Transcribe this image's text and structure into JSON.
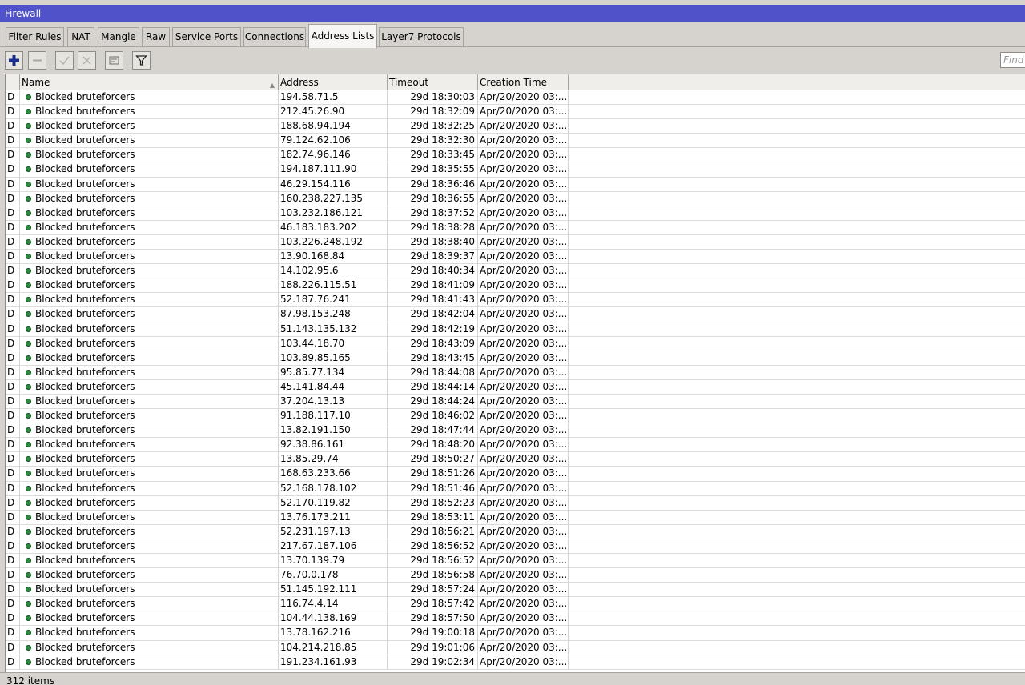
{
  "window": {
    "title": "Firewall"
  },
  "tabs": [
    {
      "label": "Filter Rules"
    },
    {
      "label": "NAT"
    },
    {
      "label": "Mangle"
    },
    {
      "label": "Raw"
    },
    {
      "label": "Service Ports"
    },
    {
      "label": "Connections"
    },
    {
      "label": "Address Lists",
      "active": true
    },
    {
      "label": "Layer7 Protocols"
    }
  ],
  "toolbar": {
    "buttons": [
      "add-icon",
      "remove-icon",
      "enable-icon",
      "disable-icon",
      "comment-icon",
      "filter-icon"
    ],
    "find_placeholder": "Find"
  },
  "table": {
    "columns": [
      "Name",
      "Address",
      "Timeout",
      "Creation Time"
    ],
    "rows": [
      {
        "flag": "D",
        "name": "Blocked bruteforcers",
        "address": "194.58.71.5",
        "timeout": "29d 18:30:03",
        "creation": "Apr/20/2020 03:..."
      },
      {
        "flag": "D",
        "name": "Blocked bruteforcers",
        "address": "212.45.26.90",
        "timeout": "29d 18:32:09",
        "creation": "Apr/20/2020 03:..."
      },
      {
        "flag": "D",
        "name": "Blocked bruteforcers",
        "address": "188.68.94.194",
        "timeout": "29d 18:32:25",
        "creation": "Apr/20/2020 03:..."
      },
      {
        "flag": "D",
        "name": "Blocked bruteforcers",
        "address": "79.124.62.106",
        "timeout": "29d 18:32:30",
        "creation": "Apr/20/2020 03:..."
      },
      {
        "flag": "D",
        "name": "Blocked bruteforcers",
        "address": "182.74.96.146",
        "timeout": "29d 18:33:45",
        "creation": "Apr/20/2020 03:..."
      },
      {
        "flag": "D",
        "name": "Blocked bruteforcers",
        "address": "194.187.111.90",
        "timeout": "29d 18:35:55",
        "creation": "Apr/20/2020 03:..."
      },
      {
        "flag": "D",
        "name": "Blocked bruteforcers",
        "address": "46.29.154.116",
        "timeout": "29d 18:36:46",
        "creation": "Apr/20/2020 03:..."
      },
      {
        "flag": "D",
        "name": "Blocked bruteforcers",
        "address": "160.238.227.135",
        "timeout": "29d 18:36:55",
        "creation": "Apr/20/2020 03:..."
      },
      {
        "flag": "D",
        "name": "Blocked bruteforcers",
        "address": "103.232.186.121",
        "timeout": "29d 18:37:52",
        "creation": "Apr/20/2020 03:..."
      },
      {
        "flag": "D",
        "name": "Blocked bruteforcers",
        "address": "46.183.183.202",
        "timeout": "29d 18:38:28",
        "creation": "Apr/20/2020 03:..."
      },
      {
        "flag": "D",
        "name": "Blocked bruteforcers",
        "address": "103.226.248.192",
        "timeout": "29d 18:38:40",
        "creation": "Apr/20/2020 03:..."
      },
      {
        "flag": "D",
        "name": "Blocked bruteforcers",
        "address": "13.90.168.84",
        "timeout": "29d 18:39:37",
        "creation": "Apr/20/2020 03:..."
      },
      {
        "flag": "D",
        "name": "Blocked bruteforcers",
        "address": "14.102.95.6",
        "timeout": "29d 18:40:34",
        "creation": "Apr/20/2020 03:..."
      },
      {
        "flag": "D",
        "name": "Blocked bruteforcers",
        "address": "188.226.115.51",
        "timeout": "29d 18:41:09",
        "creation": "Apr/20/2020 03:..."
      },
      {
        "flag": "D",
        "name": "Blocked bruteforcers",
        "address": "52.187.76.241",
        "timeout": "29d 18:41:43",
        "creation": "Apr/20/2020 03:..."
      },
      {
        "flag": "D",
        "name": "Blocked bruteforcers",
        "address": "87.98.153.248",
        "timeout": "29d 18:42:04",
        "creation": "Apr/20/2020 03:..."
      },
      {
        "flag": "D",
        "name": "Blocked bruteforcers",
        "address": "51.143.135.132",
        "timeout": "29d 18:42:19",
        "creation": "Apr/20/2020 03:..."
      },
      {
        "flag": "D",
        "name": "Blocked bruteforcers",
        "address": "103.44.18.70",
        "timeout": "29d 18:43:09",
        "creation": "Apr/20/2020 03:..."
      },
      {
        "flag": "D",
        "name": "Blocked bruteforcers",
        "address": "103.89.85.165",
        "timeout": "29d 18:43:45",
        "creation": "Apr/20/2020 03:..."
      },
      {
        "flag": "D",
        "name": "Blocked bruteforcers",
        "address": "95.85.77.134",
        "timeout": "29d 18:44:08",
        "creation": "Apr/20/2020 03:..."
      },
      {
        "flag": "D",
        "name": "Blocked bruteforcers",
        "address": "45.141.84.44",
        "timeout": "29d 18:44:14",
        "creation": "Apr/20/2020 03:..."
      },
      {
        "flag": "D",
        "name": "Blocked bruteforcers",
        "address": "37.204.13.13",
        "timeout": "29d 18:44:24",
        "creation": "Apr/20/2020 03:..."
      },
      {
        "flag": "D",
        "name": "Blocked bruteforcers",
        "address": "91.188.117.10",
        "timeout": "29d 18:46:02",
        "creation": "Apr/20/2020 03:..."
      },
      {
        "flag": "D",
        "name": "Blocked bruteforcers",
        "address": "13.82.191.150",
        "timeout": "29d 18:47:44",
        "creation": "Apr/20/2020 03:..."
      },
      {
        "flag": "D",
        "name": "Blocked bruteforcers",
        "address": "92.38.86.161",
        "timeout": "29d 18:48:20",
        "creation": "Apr/20/2020 03:..."
      },
      {
        "flag": "D",
        "name": "Blocked bruteforcers",
        "address": "13.85.29.74",
        "timeout": "29d 18:50:27",
        "creation": "Apr/20/2020 03:..."
      },
      {
        "flag": "D",
        "name": "Blocked bruteforcers",
        "address": "168.63.233.66",
        "timeout": "29d 18:51:26",
        "creation": "Apr/20/2020 03:..."
      },
      {
        "flag": "D",
        "name": "Blocked bruteforcers",
        "address": "52.168.178.102",
        "timeout": "29d 18:51:46",
        "creation": "Apr/20/2020 03:..."
      },
      {
        "flag": "D",
        "name": "Blocked bruteforcers",
        "address": "52.170.119.82",
        "timeout": "29d 18:52:23",
        "creation": "Apr/20/2020 03:..."
      },
      {
        "flag": "D",
        "name": "Blocked bruteforcers",
        "address": "13.76.173.211",
        "timeout": "29d 18:53:11",
        "creation": "Apr/20/2020 03:..."
      },
      {
        "flag": "D",
        "name": "Blocked bruteforcers",
        "address": "52.231.197.13",
        "timeout": "29d 18:56:21",
        "creation": "Apr/20/2020 03:..."
      },
      {
        "flag": "D",
        "name": "Blocked bruteforcers",
        "address": "217.67.187.106",
        "timeout": "29d 18:56:52",
        "creation": "Apr/20/2020 03:..."
      },
      {
        "flag": "D",
        "name": "Blocked bruteforcers",
        "address": "13.70.139.79",
        "timeout": "29d 18:56:52",
        "creation": "Apr/20/2020 03:..."
      },
      {
        "flag": "D",
        "name": "Blocked bruteforcers",
        "address": "76.70.0.178",
        "timeout": "29d 18:56:58",
        "creation": "Apr/20/2020 03:..."
      },
      {
        "flag": "D",
        "name": "Blocked bruteforcers",
        "address": "51.145.192.111",
        "timeout": "29d 18:57:24",
        "creation": "Apr/20/2020 03:..."
      },
      {
        "flag": "D",
        "name": "Blocked bruteforcers",
        "address": "116.74.4.14",
        "timeout": "29d 18:57:42",
        "creation": "Apr/20/2020 03:..."
      },
      {
        "flag": "D",
        "name": "Blocked bruteforcers",
        "address": "104.44.138.169",
        "timeout": "29d 18:57:50",
        "creation": "Apr/20/2020 03:..."
      },
      {
        "flag": "D",
        "name": "Blocked bruteforcers",
        "address": "13.78.162.216",
        "timeout": "29d 19:00:18",
        "creation": "Apr/20/2020 03:..."
      },
      {
        "flag": "D",
        "name": "Blocked bruteforcers",
        "address": "104.214.218.85",
        "timeout": "29d 19:01:06",
        "creation": "Apr/20/2020 03:..."
      },
      {
        "flag": "D",
        "name": "Blocked bruteforcers",
        "address": "191.234.161.93",
        "timeout": "29d 19:02:34",
        "creation": "Apr/20/2020 03:..."
      }
    ]
  },
  "status": {
    "text": "312 items"
  },
  "colors": {
    "titlebar": "#4f52c8",
    "chrome": "#d6d3ce",
    "status_dot": "#2e8b3e"
  }
}
